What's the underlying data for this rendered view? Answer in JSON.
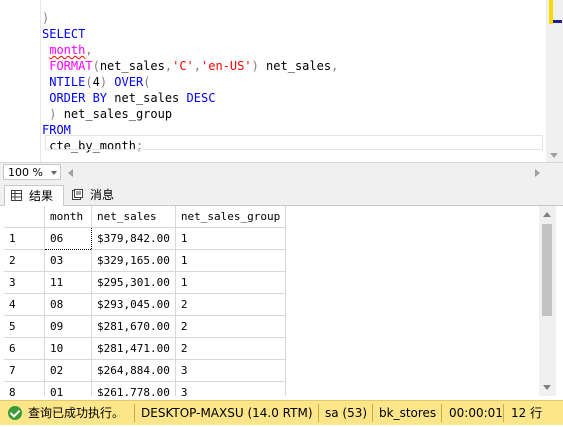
{
  "editor": {
    "lines": [
      {
        "parts": [
          {
            "t": "",
            "c": "tx"
          }
        ]
      },
      {
        "parts": [
          {
            "t": ")",
            "c": "gr"
          }
        ]
      },
      {
        "parts": [
          {
            "t": "SELECT",
            "c": "kw"
          }
        ]
      },
      {
        "parts": [
          {
            "t": " ",
            "c": "tx"
          },
          {
            "t": "month",
            "c": "fn squig"
          },
          {
            "t": ",",
            "c": "gr"
          }
        ]
      },
      {
        "parts": [
          {
            "t": " ",
            "c": "tx"
          },
          {
            "t": "FORMAT",
            "c": "fn"
          },
          {
            "t": "(",
            "c": "gr"
          },
          {
            "t": "net_sales",
            "c": "tx"
          },
          {
            "t": ",",
            "c": "gr"
          },
          {
            "t": "'C'",
            "c": "str"
          },
          {
            "t": ",",
            "c": "gr"
          },
          {
            "t": "'en-US'",
            "c": "str"
          },
          {
            "t": ")",
            "c": "gr"
          },
          {
            "t": " net_sales",
            "c": "tx"
          },
          {
            "t": ",",
            "c": "gr"
          }
        ]
      },
      {
        "parts": [
          {
            "t": " ",
            "c": "tx"
          },
          {
            "t": "NTILE",
            "c": "kw"
          },
          {
            "t": "(",
            "c": "gr"
          },
          {
            "t": "4",
            "c": "tx"
          },
          {
            "t": ")",
            "c": "gr"
          },
          {
            "t": " ",
            "c": "tx"
          },
          {
            "t": "OVER",
            "c": "kw"
          },
          {
            "t": "(",
            "c": "gr"
          }
        ]
      },
      {
        "parts": [
          {
            "t": " ",
            "c": "tx"
          },
          {
            "t": "ORDER BY",
            "c": "kw"
          },
          {
            "t": " net_sales ",
            "c": "tx"
          },
          {
            "t": "DESC",
            "c": "kw"
          }
        ]
      },
      {
        "parts": [
          {
            "t": " ",
            "c": "tx"
          },
          {
            "t": ")",
            "c": "gr"
          },
          {
            "t": " net_sales_group",
            "c": "tx"
          }
        ]
      },
      {
        "parts": [
          {
            "t": "FROM",
            "c": "kw"
          }
        ]
      },
      {
        "parts": [
          {
            "t": " cte_by_month",
            "c": "tx"
          },
          {
            "t": ";",
            "c": "gr"
          }
        ]
      }
    ]
  },
  "zoom": {
    "value": "100 %"
  },
  "tabs": {
    "results": "结果",
    "messages": "消息"
  },
  "grid": {
    "columns": [
      "month",
      "net_sales",
      "net_sales_group"
    ],
    "rows": [
      {
        "n": "1",
        "month": "06",
        "net_sales": "$379,842.00",
        "group": "1"
      },
      {
        "n": "2",
        "month": "03",
        "net_sales": "$329,165.00",
        "group": "1"
      },
      {
        "n": "3",
        "month": "11",
        "net_sales": "$295,301.00",
        "group": "1"
      },
      {
        "n": "4",
        "month": "08",
        "net_sales": "$293,045.00",
        "group": "2"
      },
      {
        "n": "5",
        "month": "09",
        "net_sales": "$281,670.00",
        "group": "2"
      },
      {
        "n": "6",
        "month": "10",
        "net_sales": "$281,471.00",
        "group": "2"
      },
      {
        "n": "7",
        "month": "02",
        "net_sales": "$264,884.00",
        "group": "3"
      },
      {
        "n": "8",
        "month": "01",
        "net_sales": "$261,778.00",
        "group": "3"
      }
    ]
  },
  "status": {
    "message": "查询已成功执行。",
    "server": "DESKTOP-MAXSU (14.0 RTM)",
    "user": "sa (53)",
    "database": "bk_stores",
    "elapsed": "00:00:01",
    "rows": "12 行"
  }
}
